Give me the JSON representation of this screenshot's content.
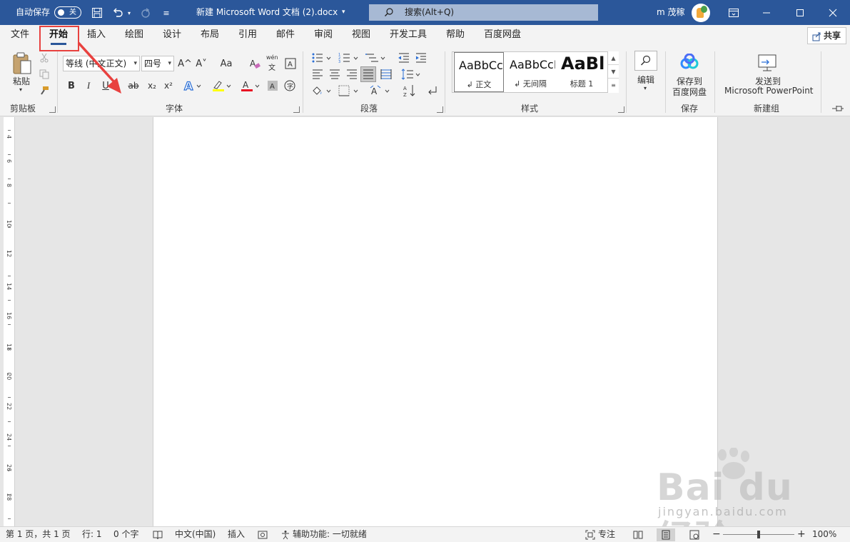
{
  "title_bar": {
    "autosave_label": "自动保存",
    "autosave_state": "关",
    "doc_title": "新建 Microsoft Word 文档 (2).docx",
    "search_placeholder": "搜索(Alt+Q)",
    "user_name": "m 茂稼"
  },
  "tabs": [
    "文件",
    "开始",
    "插入",
    "绘图",
    "设计",
    "布局",
    "引用",
    "邮件",
    "审阅",
    "视图",
    "开发工具",
    "帮助",
    "百度网盘"
  ],
  "active_tab": "开始",
  "share_label": "共享",
  "ribbon": {
    "clipboard": {
      "paste_label": "粘贴",
      "group_label": "剪贴板"
    },
    "font": {
      "font_name": "等线 (中文正文)",
      "font_size": "四号",
      "group_label": "字体",
      "bold": "B",
      "italic": "I",
      "underline": "U",
      "strike": "ab",
      "sub": "x₂",
      "sup": "x²",
      "grow": "A^",
      "shrink": "A˅",
      "case": "Aa",
      "phonetic_top": "wén",
      "phonetic_bottom": "文"
    },
    "paragraph": {
      "group_label": "段落"
    },
    "styles": {
      "group_label": "样式",
      "items": [
        {
          "preview": "AaBbCcI",
          "name": "↲ 正文"
        },
        {
          "preview": "AaBbCcI",
          "name": "↲ 无间隔"
        },
        {
          "preview": "AaBl",
          "name": "标题 1"
        }
      ]
    },
    "editing": {
      "label": "编辑"
    },
    "save": {
      "label_line1": "保存到",
      "label_line2": "百度网盘",
      "group_label": "保存"
    },
    "newgroup": {
      "label_line1": "发送到",
      "label_line2": "Microsoft PowerPoint",
      "group_label": "新建组"
    }
  },
  "ruler_numbers": [
    "4",
    "6",
    "8",
    "10",
    "12",
    "14",
    "16",
    "18",
    "20",
    "22",
    "24",
    "26",
    "28"
  ],
  "status_bar": {
    "page_info": "第 1 页，共 1 页",
    "line_info": "行: 1",
    "word_count": "0 个字",
    "language": "中文(中国)",
    "insert_mode": "插入",
    "accessibility": "辅助功能: 一切就绪",
    "focus": "专注",
    "zoom_minus": "−",
    "zoom_plus": "+",
    "zoom": "100%"
  },
  "zoom_percent": 100,
  "watermark": {
    "text": "Bai du 经验",
    "sub": "jingyan.baidu.com"
  },
  "colors": {
    "title_bar": "#2b579a",
    "highlight_box": "#e8413f",
    "arrow": "#e8413f",
    "font_color": "#e81123",
    "highlight_color": "#ffff00"
  }
}
